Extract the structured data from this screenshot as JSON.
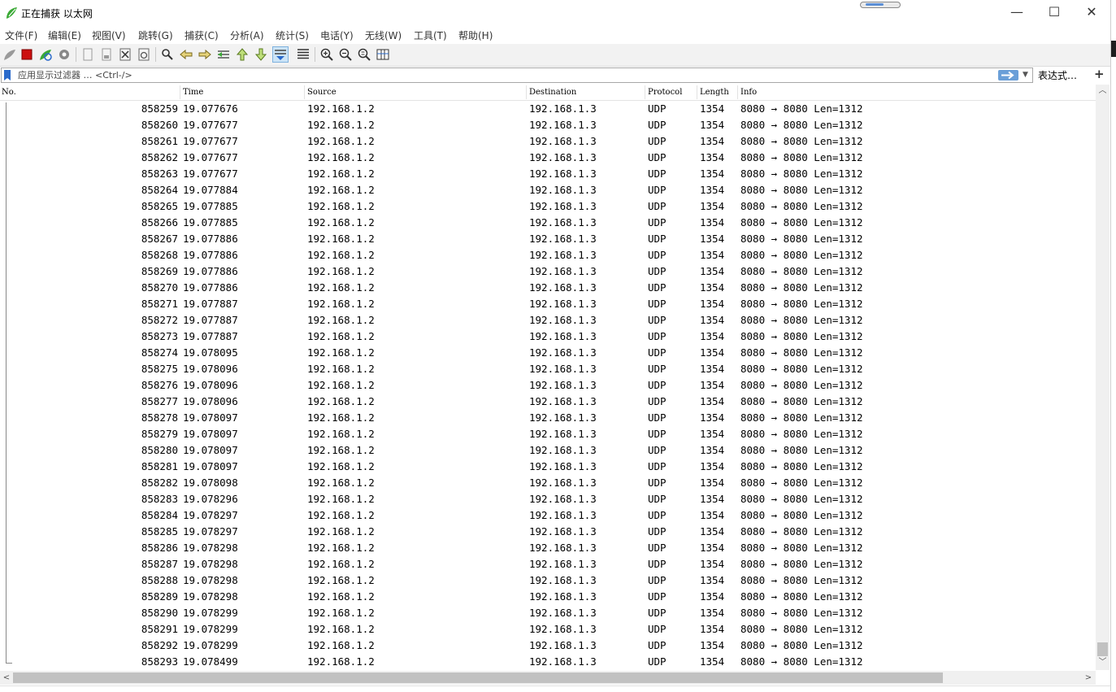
{
  "window": {
    "title": "正在捕获 以太网",
    "min_symbol": "—",
    "max_symbol": "☐",
    "close_symbol": "✕"
  },
  "menu": [
    "文件(F)",
    "编辑(E)",
    "视图(V)",
    "跳转(G)",
    "捕获(C)",
    "分析(A)",
    "统计(S)",
    "电话(Y)",
    "无线(W)",
    "工具(T)",
    "帮助(H)"
  ],
  "toolbar": {
    "icons": [
      "shark-fin-start-icon",
      "stop-capture-icon",
      "restart-capture-icon",
      "capture-options-icon",
      "open-file-icon",
      "save-file-icon",
      "close-file-icon",
      "reload-file-icon",
      "find-packet-icon",
      "go-back-icon",
      "go-forward-icon",
      "go-to-packet-icon",
      "first-packet-icon",
      "last-packet-icon",
      "auto-scroll-icon",
      "colorize-icon",
      "zoom-in-icon",
      "zoom-out-icon",
      "normal-size-icon",
      "resize-columns-icon"
    ],
    "active_icon": "auto-scroll-icon"
  },
  "filter": {
    "placeholder": "应用显示过滤器 … <Ctrl-/>",
    "value": "",
    "expression_label": "表达式…",
    "add_label": "+",
    "dropdown_symbol": "▼"
  },
  "columns": {
    "no": "No.",
    "time": "Time",
    "source": "Source",
    "destination": "Destination",
    "protocol": "Protocol",
    "length": "Length",
    "info": "Info"
  },
  "packets": [
    {
      "no": "858259",
      "time": "19.077676",
      "src": "192.168.1.2",
      "dst": "192.168.1.3",
      "proto": "UDP",
      "len": "1354",
      "info": "8080 → 8080 Len=1312"
    },
    {
      "no": "858260",
      "time": "19.077677",
      "src": "192.168.1.2",
      "dst": "192.168.1.3",
      "proto": "UDP",
      "len": "1354",
      "info": "8080 → 8080 Len=1312"
    },
    {
      "no": "858261",
      "time": "19.077677",
      "src": "192.168.1.2",
      "dst": "192.168.1.3",
      "proto": "UDP",
      "len": "1354",
      "info": "8080 → 8080 Len=1312"
    },
    {
      "no": "858262",
      "time": "19.077677",
      "src": "192.168.1.2",
      "dst": "192.168.1.3",
      "proto": "UDP",
      "len": "1354",
      "info": "8080 → 8080 Len=1312"
    },
    {
      "no": "858263",
      "time": "19.077677",
      "src": "192.168.1.2",
      "dst": "192.168.1.3",
      "proto": "UDP",
      "len": "1354",
      "info": "8080 → 8080 Len=1312"
    },
    {
      "no": "858264",
      "time": "19.077884",
      "src": "192.168.1.2",
      "dst": "192.168.1.3",
      "proto": "UDP",
      "len": "1354",
      "info": "8080 → 8080 Len=1312"
    },
    {
      "no": "858265",
      "time": "19.077885",
      "src": "192.168.1.2",
      "dst": "192.168.1.3",
      "proto": "UDP",
      "len": "1354",
      "info": "8080 → 8080 Len=1312"
    },
    {
      "no": "858266",
      "time": "19.077885",
      "src": "192.168.1.2",
      "dst": "192.168.1.3",
      "proto": "UDP",
      "len": "1354",
      "info": "8080 → 8080 Len=1312"
    },
    {
      "no": "858267",
      "time": "19.077886",
      "src": "192.168.1.2",
      "dst": "192.168.1.3",
      "proto": "UDP",
      "len": "1354",
      "info": "8080 → 8080 Len=1312"
    },
    {
      "no": "858268",
      "time": "19.077886",
      "src": "192.168.1.2",
      "dst": "192.168.1.3",
      "proto": "UDP",
      "len": "1354",
      "info": "8080 → 8080 Len=1312"
    },
    {
      "no": "858269",
      "time": "19.077886",
      "src": "192.168.1.2",
      "dst": "192.168.1.3",
      "proto": "UDP",
      "len": "1354",
      "info": "8080 → 8080 Len=1312"
    },
    {
      "no": "858270",
      "time": "19.077886",
      "src": "192.168.1.2",
      "dst": "192.168.1.3",
      "proto": "UDP",
      "len": "1354",
      "info": "8080 → 8080 Len=1312"
    },
    {
      "no": "858271",
      "time": "19.077887",
      "src": "192.168.1.2",
      "dst": "192.168.1.3",
      "proto": "UDP",
      "len": "1354",
      "info": "8080 → 8080 Len=1312"
    },
    {
      "no": "858272",
      "time": "19.077887",
      "src": "192.168.1.2",
      "dst": "192.168.1.3",
      "proto": "UDP",
      "len": "1354",
      "info": "8080 → 8080 Len=1312"
    },
    {
      "no": "858273",
      "time": "19.077887",
      "src": "192.168.1.2",
      "dst": "192.168.1.3",
      "proto": "UDP",
      "len": "1354",
      "info": "8080 → 8080 Len=1312"
    },
    {
      "no": "858274",
      "time": "19.078095",
      "src": "192.168.1.2",
      "dst": "192.168.1.3",
      "proto": "UDP",
      "len": "1354",
      "info": "8080 → 8080 Len=1312"
    },
    {
      "no": "858275",
      "time": "19.078096",
      "src": "192.168.1.2",
      "dst": "192.168.1.3",
      "proto": "UDP",
      "len": "1354",
      "info": "8080 → 8080 Len=1312"
    },
    {
      "no": "858276",
      "time": "19.078096",
      "src": "192.168.1.2",
      "dst": "192.168.1.3",
      "proto": "UDP",
      "len": "1354",
      "info": "8080 → 8080 Len=1312"
    },
    {
      "no": "858277",
      "time": "19.078096",
      "src": "192.168.1.2",
      "dst": "192.168.1.3",
      "proto": "UDP",
      "len": "1354",
      "info": "8080 → 8080 Len=1312"
    },
    {
      "no": "858278",
      "time": "19.078097",
      "src": "192.168.1.2",
      "dst": "192.168.1.3",
      "proto": "UDP",
      "len": "1354",
      "info": "8080 → 8080 Len=1312"
    },
    {
      "no": "858279",
      "time": "19.078097",
      "src": "192.168.1.2",
      "dst": "192.168.1.3",
      "proto": "UDP",
      "len": "1354",
      "info": "8080 → 8080 Len=1312"
    },
    {
      "no": "858280",
      "time": "19.078097",
      "src": "192.168.1.2",
      "dst": "192.168.1.3",
      "proto": "UDP",
      "len": "1354",
      "info": "8080 → 8080 Len=1312"
    },
    {
      "no": "858281",
      "time": "19.078097",
      "src": "192.168.1.2",
      "dst": "192.168.1.3",
      "proto": "UDP",
      "len": "1354",
      "info": "8080 → 8080 Len=1312"
    },
    {
      "no": "858282",
      "time": "19.078098",
      "src": "192.168.1.2",
      "dst": "192.168.1.3",
      "proto": "UDP",
      "len": "1354",
      "info": "8080 → 8080 Len=1312"
    },
    {
      "no": "858283",
      "time": "19.078296",
      "src": "192.168.1.2",
      "dst": "192.168.1.3",
      "proto": "UDP",
      "len": "1354",
      "info": "8080 → 8080 Len=1312"
    },
    {
      "no": "858284",
      "time": "19.078297",
      "src": "192.168.1.2",
      "dst": "192.168.1.3",
      "proto": "UDP",
      "len": "1354",
      "info": "8080 → 8080 Len=1312"
    },
    {
      "no": "858285",
      "time": "19.078297",
      "src": "192.168.1.2",
      "dst": "192.168.1.3",
      "proto": "UDP",
      "len": "1354",
      "info": "8080 → 8080 Len=1312"
    },
    {
      "no": "858286",
      "time": "19.078298",
      "src": "192.168.1.2",
      "dst": "192.168.1.3",
      "proto": "UDP",
      "len": "1354",
      "info": "8080 → 8080 Len=1312"
    },
    {
      "no": "858287",
      "time": "19.078298",
      "src": "192.168.1.2",
      "dst": "192.168.1.3",
      "proto": "UDP",
      "len": "1354",
      "info": "8080 → 8080 Len=1312"
    },
    {
      "no": "858288",
      "time": "19.078298",
      "src": "192.168.1.2",
      "dst": "192.168.1.3",
      "proto": "UDP",
      "len": "1354",
      "info": "8080 → 8080 Len=1312"
    },
    {
      "no": "858289",
      "time": "19.078298",
      "src": "192.168.1.2",
      "dst": "192.168.1.3",
      "proto": "UDP",
      "len": "1354",
      "info": "8080 → 8080 Len=1312"
    },
    {
      "no": "858290",
      "time": "19.078299",
      "src": "192.168.1.2",
      "dst": "192.168.1.3",
      "proto": "UDP",
      "len": "1354",
      "info": "8080 → 8080 Len=1312"
    },
    {
      "no": "858291",
      "time": "19.078299",
      "src": "192.168.1.2",
      "dst": "192.168.1.3",
      "proto": "UDP",
      "len": "1354",
      "info": "8080 → 8080 Len=1312"
    },
    {
      "no": "858292",
      "time": "19.078299",
      "src": "192.168.1.2",
      "dst": "192.168.1.3",
      "proto": "UDP",
      "len": "1354",
      "info": "8080 → 8080 Len=1312"
    },
    {
      "no": "858293",
      "time": "19.078499",
      "src": "192.168.1.2",
      "dst": "192.168.1.3",
      "proto": "UDP",
      "len": "1354",
      "info": "8080 → 8080 Len=1312"
    }
  ],
  "colors": {
    "toolbar_bg": "#f2f2f2",
    "accent_blue": "#2a6acb",
    "stop_red": "#cc1010",
    "logo_green": "#3aa935"
  }
}
